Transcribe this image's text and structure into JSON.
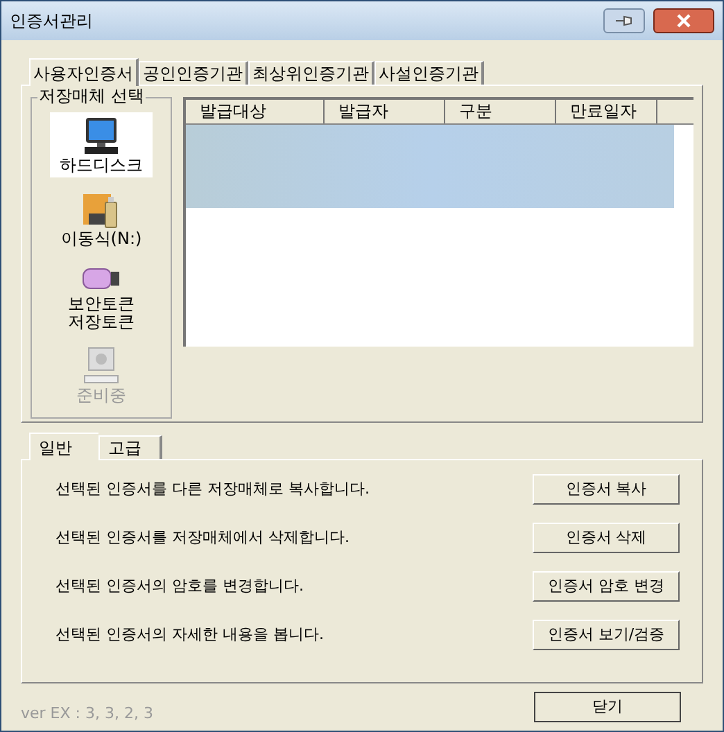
{
  "window": {
    "title": "인증서관리"
  },
  "tabs": [
    {
      "label": "사용자인증서",
      "selected": true
    },
    {
      "label": "공인인증기관",
      "selected": false
    },
    {
      "label": "최상위인증기관",
      "selected": false
    },
    {
      "label": "사설인증기관",
      "selected": false
    }
  ],
  "storage": {
    "title": "저장매체 선택",
    "media": [
      {
        "kind": "disk",
        "label": "하드디스크",
        "selected": true,
        "disabled": false
      },
      {
        "kind": "removable",
        "label": "이동식(N:)",
        "selected": false,
        "disabled": false
      },
      {
        "kind": "token",
        "label": "보안토큰\n저장토큰",
        "selected": false,
        "disabled": false
      },
      {
        "kind": "pending",
        "label": "준비중",
        "selected": false,
        "disabled": true
      }
    ]
  },
  "table": {
    "columns": [
      "발급대상",
      "발급자",
      "구분",
      "만료일자"
    ],
    "rows": [
      {
        "selected": true
      }
    ]
  },
  "sub_tabs": [
    {
      "label": "일반",
      "selected": true
    },
    {
      "label": "고급",
      "selected": false
    }
  ],
  "actions": [
    {
      "description": "선택된 인증서를 다른 저장매체로 복사합니다.",
      "button": "인증서 복사"
    },
    {
      "description": "선택된 인증서를 저장매체에서 삭제합니다.",
      "button": "인증서 삭제"
    },
    {
      "description": "선택된 인증서의 암호를 변경합니다.",
      "button": "인증서 암호 변경"
    },
    {
      "description": "선택된 인증서의 자세한 내용을 봅니다.",
      "button": "인증서 보기/검증"
    }
  ],
  "close_button": "닫기",
  "version": "ver EX : 3, 3, 2, 3"
}
